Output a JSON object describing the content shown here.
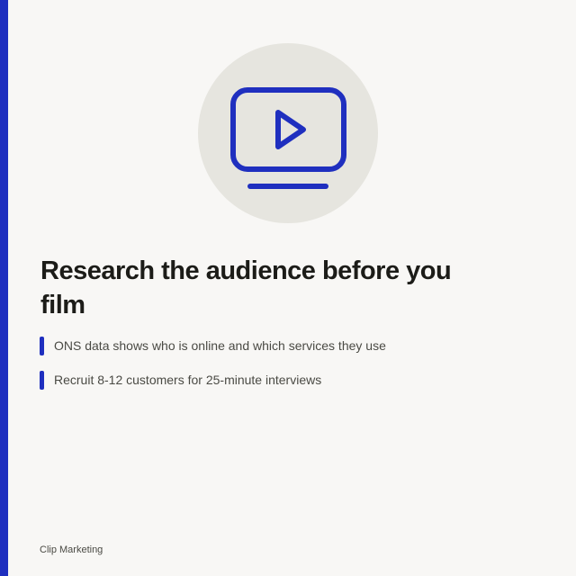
{
  "slide": {
    "title": "Research the audience before you film",
    "bullets": [
      "ONS data shows who is online and which services they use",
      "Recruit 8-12 customers for 25-minute interviews"
    ],
    "footer": "Clip Marketing"
  },
  "icon": {
    "name": "video-monitor-icon"
  },
  "colors": {
    "accent": "#1f2fbf",
    "background": "#f8f7f5",
    "hero_circle": "#e6e5df",
    "title_text": "#1c1c18",
    "body_text": "#4a4a44"
  }
}
